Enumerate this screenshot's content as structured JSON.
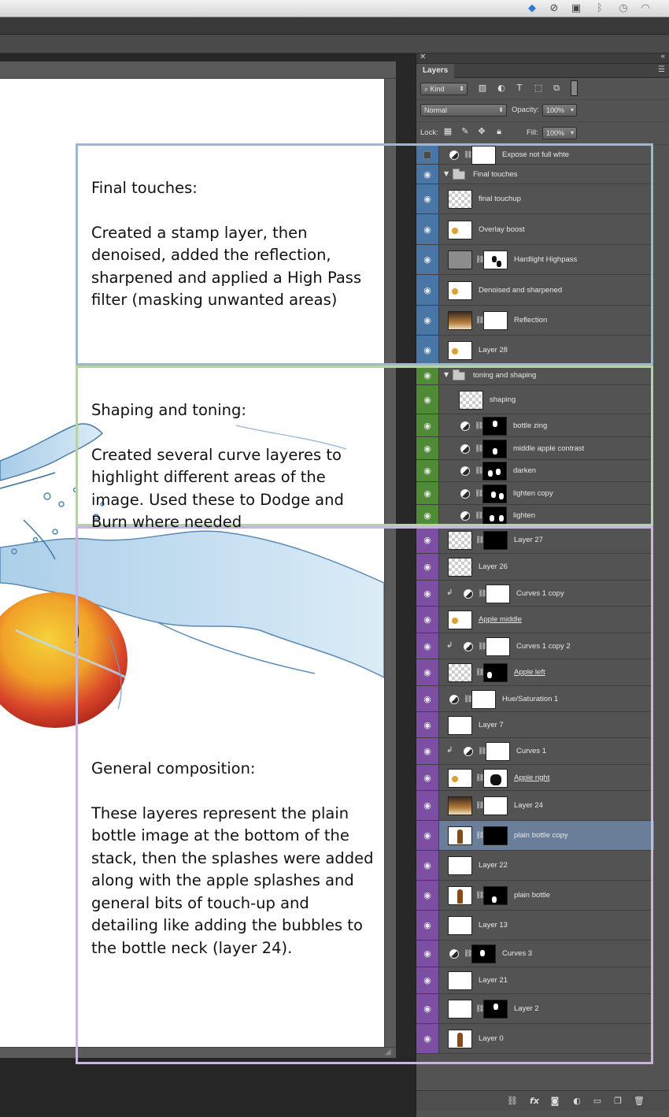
{
  "menubar": {
    "tray_icons": [
      "dropbox-icon",
      "alert-icon",
      "clipboard-icon",
      "bluetooth-icon",
      "time-machine-icon",
      "wifi-icon"
    ]
  },
  "layers_panel": {
    "tab_label": "Layers",
    "filter": {
      "kind_label": "Kind",
      "icons": [
        "image-filter-icon",
        "adjustment-filter-icon",
        "type-filter-icon",
        "shape-filter-icon",
        "smart-object-filter-icon",
        "filter-toggle-icon"
      ]
    },
    "blend_mode": "Normal",
    "opacity_label": "Opacity:",
    "opacity_value": "100%",
    "lock_label": "Lock:",
    "fill_label": "Fill:",
    "fill_value": "100%",
    "layers": [
      {
        "name": "Expose not full whte",
        "visible": false,
        "group": "final"
      },
      {
        "name": "Final touches",
        "visible": true,
        "group": "final",
        "kind": "folder"
      },
      {
        "name": "final touchup",
        "visible": true,
        "group": "final"
      },
      {
        "name": "Overlay boost",
        "visible": true,
        "group": "final"
      },
      {
        "name": "Hardlight Highpass",
        "visible": true,
        "group": "final"
      },
      {
        "name": "Denoised and sharpened",
        "visible": true,
        "group": "final"
      },
      {
        "name": "Reflection",
        "visible": true,
        "group": "final"
      },
      {
        "name": "Layer 28",
        "visible": true,
        "group": "final"
      },
      {
        "name": "toning and shaping",
        "visible": true,
        "group": "toning",
        "kind": "folder"
      },
      {
        "name": "shaping",
        "visible": true,
        "group": "toning"
      },
      {
        "name": "bottle zing",
        "visible": true,
        "group": "toning"
      },
      {
        "name": "middle apple contrast",
        "visible": true,
        "group": "toning"
      },
      {
        "name": "darken",
        "visible": true,
        "group": "toning"
      },
      {
        "name": "lighten copy",
        "visible": true,
        "group": "toning"
      },
      {
        "name": "lighten",
        "visible": true,
        "group": "toning"
      },
      {
        "name": "Layer 27",
        "visible": true,
        "group": "general"
      },
      {
        "name": "Layer 26",
        "visible": true,
        "group": "general"
      },
      {
        "name": "Curves 1 copy",
        "visible": true,
        "group": "general"
      },
      {
        "name": "Apple middle",
        "visible": true,
        "group": "general"
      },
      {
        "name": "Curves 1 copy 2",
        "visible": true,
        "group": "general"
      },
      {
        "name": "Apple left",
        "visible": true,
        "group": "general"
      },
      {
        "name": "Hue/Saturation 1",
        "visible": true,
        "group": "general"
      },
      {
        "name": "Layer 7",
        "visible": true,
        "group": "general"
      },
      {
        "name": "Curves 1",
        "visible": true,
        "group": "general"
      },
      {
        "name": "Apple right",
        "visible": true,
        "group": "general"
      },
      {
        "name": "Layer 24",
        "visible": true,
        "group": "general"
      },
      {
        "name": "plain bottle copy",
        "visible": true,
        "group": "general",
        "selected": true
      },
      {
        "name": "Layer 22",
        "visible": true,
        "group": "general"
      },
      {
        "name": "plain bottle",
        "visible": true,
        "group": "general"
      },
      {
        "name": "Layer 13",
        "visible": true,
        "group": "general"
      },
      {
        "name": "Curves 3",
        "visible": true,
        "group": "general"
      },
      {
        "name": "Layer 21",
        "visible": true,
        "group": "general"
      },
      {
        "name": "Layer 2",
        "visible": true,
        "group": "general"
      },
      {
        "name": "Layer 0",
        "visible": true,
        "group": "general"
      }
    ],
    "footer_icons": [
      "link-layers-icon",
      "fx-icon",
      "add-mask-icon",
      "new-adjustment-icon",
      "new-group-icon",
      "new-layer-icon",
      "delete-layer-icon"
    ]
  },
  "annotations": {
    "final": {
      "heading": "Final touches:",
      "body": "Created a stamp layer, then\ndenoised, added the reflection,\nsharpened and applied a High Pass\nfilter (masking unwanted areas)"
    },
    "toning": {
      "heading": "Shaping and toning:",
      "body": "Created several curve layeres to\nhighlight different areas of the\nimage. Used these to Dodge and\nBurn where needed"
    },
    "general": {
      "heading": "General composition:",
      "body": "These layeres represent the plain\nbottle image at the bottom of the\nstack, then the splashes were added\nalong with the apple splashes and\ngeneral bits of touch-up and\ndetailing like adding the bubbles to\nthe bottle neck (layer 24)."
    }
  },
  "colors": {
    "final_group": "#4a76a5",
    "toning_group": "#4f8a36",
    "general_group": "#7c4fa3",
    "final_box": "#9fb6d0",
    "toning_box": "#b8d2a8",
    "general_box": "#c9b6dc",
    "selected_row": "#6a7e99"
  }
}
